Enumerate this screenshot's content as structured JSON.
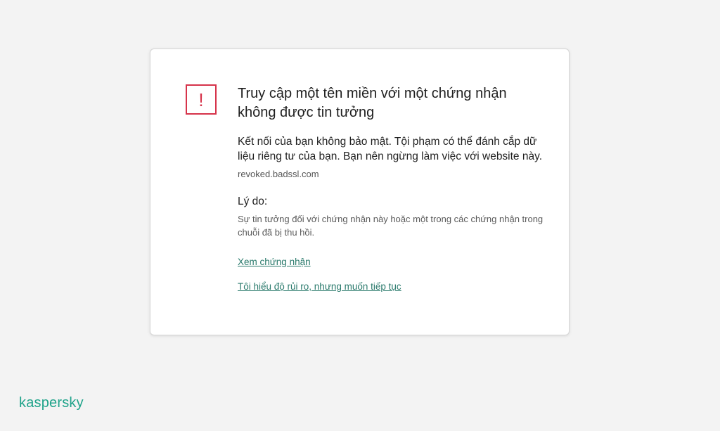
{
  "card": {
    "title": "Truy cập một tên miền với một chứng nhận không được tin tưởng",
    "description": "Kết nối của bạn không bảo mật. Tội phạm có thể đánh cắp dữ liệu riêng tư của bạn. Bạn nên ngừng làm việc với website này.",
    "domain": "revoked.badssl.com",
    "reason_heading": "Lý do:",
    "reason_text": "Sự tin tưởng đối với chứng nhận này hoặc một trong các chứng nhận trong chuỗi đã bị thu hồi.",
    "view_certificate_link": "Xem chứng nhận",
    "continue_link": "Tôi hiểu độ rủi ro, nhưng muốn tiếp tục",
    "warning_icon": "!",
    "icon_name": "warning-exclamation-icon"
  },
  "brand": {
    "logo_text": "kaspersky"
  },
  "colors": {
    "background": "#f3f3f3",
    "warning_red": "#d6334a",
    "link_teal": "#2a7a6c",
    "brand_green": "#1fa38a"
  }
}
